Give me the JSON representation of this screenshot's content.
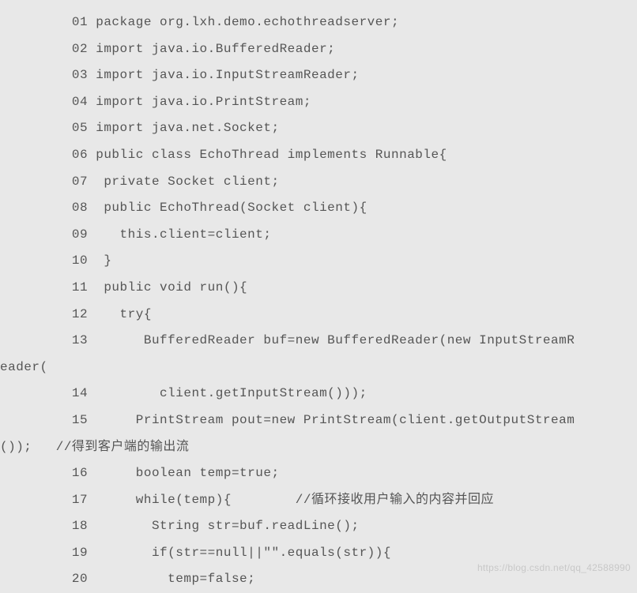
{
  "code_lines": [
    {
      "indent": "         ",
      "num": "01",
      "code": " package org.lxh.demo.echothreadserver;"
    },
    {
      "indent": "         ",
      "num": "02",
      "code": " import java.io.BufferedReader;"
    },
    {
      "indent": "         ",
      "num": "03",
      "code": " import java.io.InputStreamReader;"
    },
    {
      "indent": "         ",
      "num": "04",
      "code": " import java.io.PrintStream;"
    },
    {
      "indent": "         ",
      "num": "05",
      "code": " import java.net.Socket;"
    },
    {
      "indent": "         ",
      "num": "06",
      "code": " public class EchoThread implements Runnable{"
    },
    {
      "indent": "         ",
      "num": "07",
      "code": "  private Socket client;"
    },
    {
      "indent": "         ",
      "num": "08",
      "code": "  public EchoThread(Socket client){"
    },
    {
      "indent": "         ",
      "num": "09",
      "code": "    this.client=client;"
    },
    {
      "indent": "         ",
      "num": "10",
      "code": "  }"
    },
    {
      "indent": "         ",
      "num": "11",
      "code": "  public void run(){"
    },
    {
      "indent": "         ",
      "num": "12",
      "code": "    try{"
    },
    {
      "indent": "         ",
      "num": "13",
      "code": "       BufferedReader buf=new BufferedReader(new InputStreamR"
    },
    {
      "indent": "",
      "num": "",
      "code": "eader("
    },
    {
      "indent": "         ",
      "num": "14",
      "code": "         client.getInputStream()));"
    },
    {
      "indent": "         ",
      "num": "15",
      "code": "      PrintStream pout=new PrintStream(client.getOutputStream"
    },
    {
      "indent": "",
      "num": "",
      "code": "());   //得到客户端的输出流"
    },
    {
      "indent": "         ",
      "num": "16",
      "code": "      boolean temp=true;"
    },
    {
      "indent": "         ",
      "num": "17",
      "code": "      while(temp){        //循环接收用户输入的内容并回应"
    },
    {
      "indent": "         ",
      "num": "18",
      "code": "        String str=buf.readLine();"
    },
    {
      "indent": "         ",
      "num": "19",
      "code": "        if(str==null||\"\".equals(str)){"
    },
    {
      "indent": "         ",
      "num": "20",
      "code": "          temp=false;"
    }
  ],
  "watermark": "https://blog.csdn.net/qq_42588990"
}
